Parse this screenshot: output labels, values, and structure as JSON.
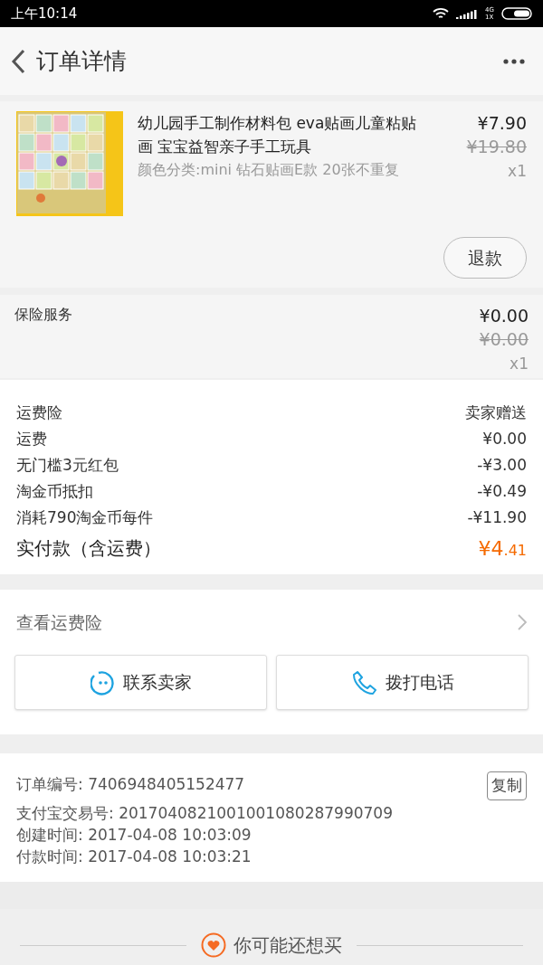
{
  "status_bar": {
    "time": "上午10:14",
    "network": "4G 1X"
  },
  "header": {
    "title": "订单详情"
  },
  "product": {
    "title": "幼儿园手工制作材料包 eva贴画儿童粘贴画 宝宝益智亲子手工玩具",
    "variant": "颜色分类:mini 钻石贴画E款 20张不重复",
    "price": "¥7.90",
    "original_price": "¥19.80",
    "quantity": "x1",
    "refund_button": "退款"
  },
  "insurance": {
    "label": "保险服务",
    "price": "¥0.00",
    "original_price": "¥0.00",
    "quantity": "x1"
  },
  "fees": [
    {
      "kind": "line",
      "label": "运费险",
      "value": "卖家赠送"
    },
    {
      "kind": "line",
      "label": "运费",
      "value": "¥0.00"
    },
    {
      "kind": "line",
      "label": "无门槛3元红包",
      "value": "-¥3.00"
    },
    {
      "kind": "line",
      "label": "淘金币抵扣",
      "value": "-¥0.49"
    },
    {
      "kind": "line",
      "label": "消耗790淘金币每件",
      "value": "-¥11.90"
    },
    {
      "kind": "total",
      "label": "实付款（含运费）",
      "value_major": "¥4",
      "value_minor": ".41"
    }
  ],
  "shipping_insurance_link": "查看运费险",
  "buttons": [
    {
      "kind": "chat",
      "label": "联系卖家"
    },
    {
      "kind": "phone",
      "label": "拨打电话"
    }
  ],
  "order_info": {
    "copy_button": "复制",
    "lines": [
      "订单编号: 7406948405152477",
      "支付宝交易号: 2017040821001001080287990709",
      "创建时间: 2017-04-08 10:03:09",
      "付款时间: 2017-04-08 10:03:21"
    ]
  },
  "recommend": {
    "title": "你可能还想买"
  }
}
